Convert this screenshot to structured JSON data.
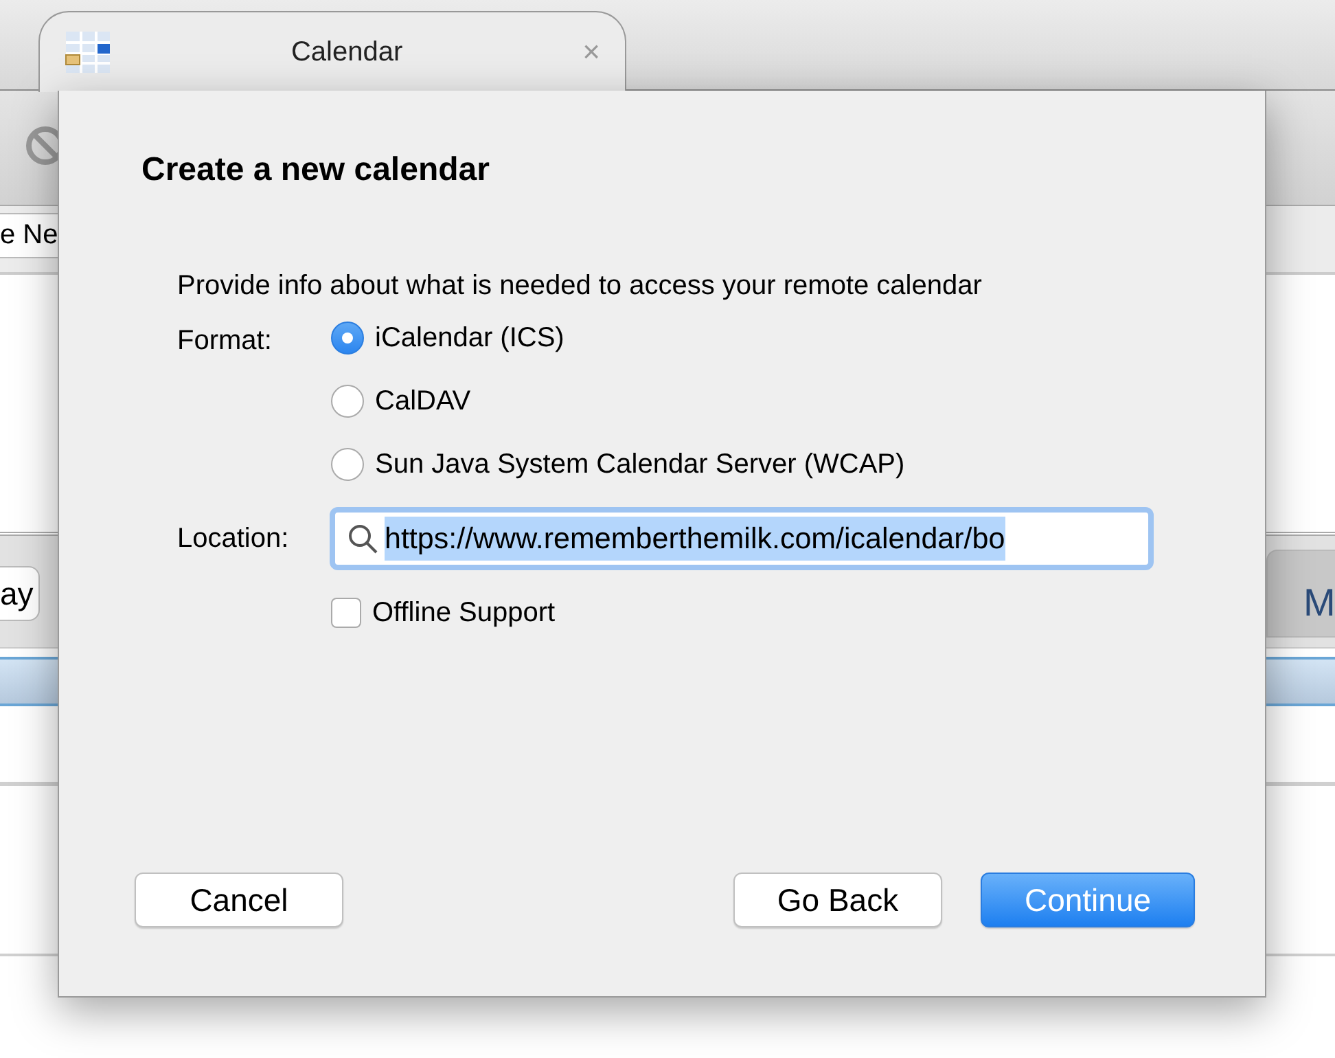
{
  "background": {
    "tab": {
      "title": "Calendar",
      "close": "×",
      "selected": true
    },
    "search_text": "e Ne",
    "left_button": "ay",
    "right_button": "M"
  },
  "dialog": {
    "title": "Create a new calendar",
    "intro": "Provide info about what is needed to access your remote calendar",
    "format_label": "Format:",
    "formats": [
      {
        "label": "iCalendar (ICS)",
        "selected": true
      },
      {
        "label": "CalDAV",
        "selected": false
      },
      {
        "label": "Sun Java System Calendar Server (WCAP)",
        "selected": false
      }
    ],
    "location_label": "Location:",
    "location": {
      "value": "https://www.rememberthemilk.com/icalendar/bo",
      "text_selected": true
    },
    "offline": {
      "label": "Offline Support",
      "checked": false
    },
    "buttons": [
      {
        "label": "Cancel",
        "kind": "secondary"
      },
      {
        "label": "Go Back",
        "kind": "secondary"
      },
      {
        "label": "Continue",
        "kind": "default"
      }
    ]
  }
}
